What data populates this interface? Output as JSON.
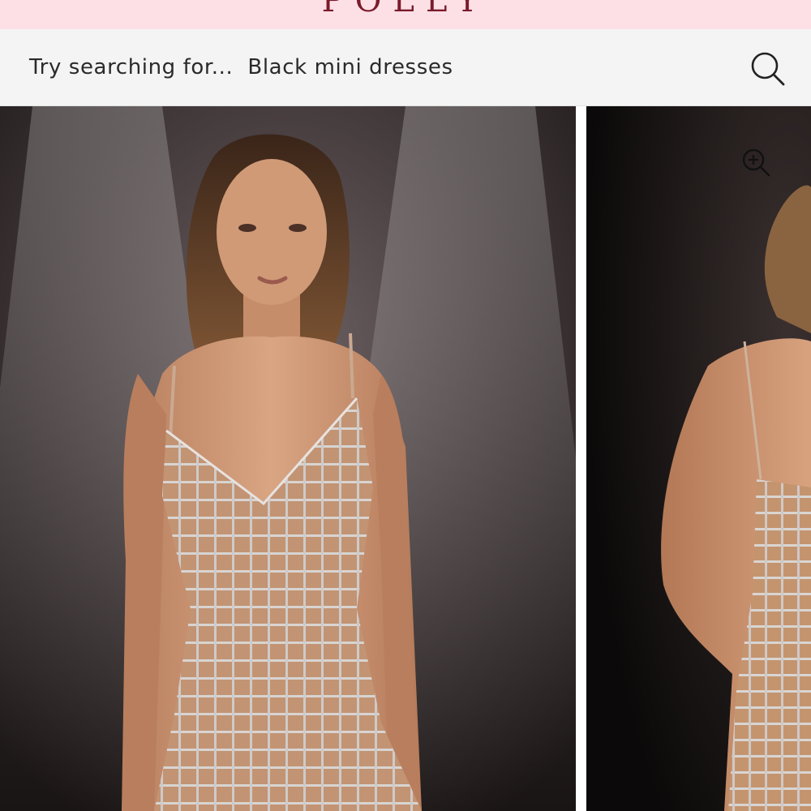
{
  "brand": {
    "logo_text": "POLLY"
  },
  "search": {
    "prompt_label": "Try searching for...",
    "suggestion": "Black mini dresses",
    "icon": "search-icon"
  },
  "gallery": {
    "slides": [
      {
        "subject": "model front view",
        "dress": "crystal grid mini dress, nude"
      },
      {
        "subject": "model back view",
        "dress": "crystal grid mini dress, nude"
      }
    ],
    "zoom_icon": "zoom-in-icon"
  },
  "colors": {
    "brand_bar": "#fde0e6",
    "logo": "#7a1b2c",
    "search_bg": "#f4f4f5",
    "text": "#2a2a2a"
  }
}
